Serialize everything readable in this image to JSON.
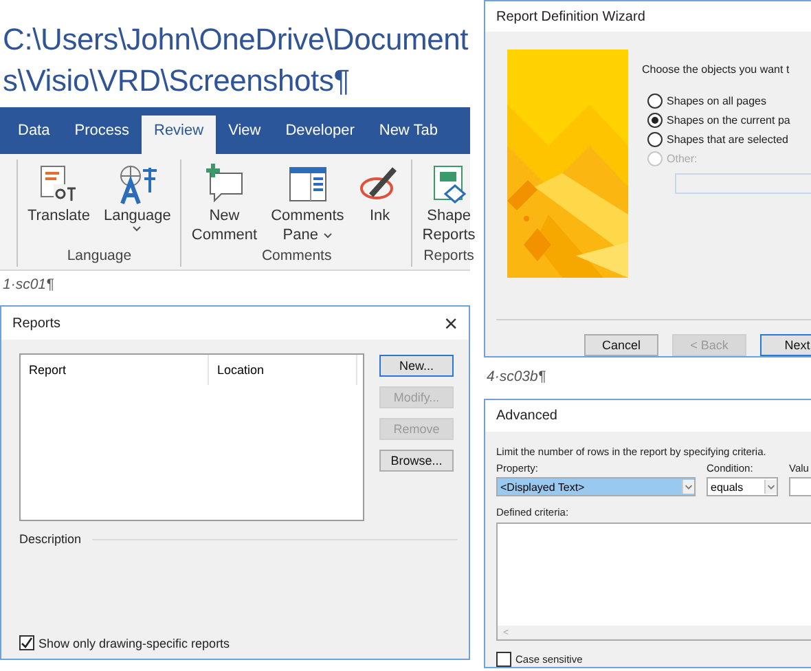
{
  "heading": {
    "lines": [
      "C:\\Users\\John\\OneDrive\\Document",
      "s\\Visio\\VRD\\Screenshots¶"
    ]
  },
  "ribbon": {
    "tabs": [
      {
        "label": "Data",
        "selected": false
      },
      {
        "label": "Process",
        "selected": false
      },
      {
        "label": "Review",
        "selected": true
      },
      {
        "label": "View",
        "selected": false
      },
      {
        "label": "Developer",
        "selected": false
      },
      {
        "label": "New Tab",
        "selected": false
      }
    ],
    "groups": [
      {
        "label": "Language",
        "commands": [
          {
            "kind": "translate",
            "lines": [
              "Translate"
            ],
            "dropdown": false
          },
          {
            "kind": "language",
            "lines": [
              "Language"
            ],
            "dropdown": true
          }
        ]
      },
      {
        "label": "Comments",
        "commands": [
          {
            "kind": "comment",
            "lines": [
              "New",
              "Comment"
            ],
            "dropdown": false
          },
          {
            "kind": "pane",
            "lines": [
              "Comments",
              "Pane"
            ],
            "dropdown": true
          },
          {
            "kind": "ink",
            "lines": [
              "Ink"
            ],
            "dropdown": false
          }
        ]
      },
      {
        "label": "Reports",
        "commands": [
          {
            "kind": "reports",
            "lines": [
              "Shape",
              "Reports"
            ],
            "dropdown": false
          }
        ]
      }
    ]
  },
  "caption_1": "1·sc01¶",
  "reports_dialog": {
    "title": "Reports",
    "close": "×",
    "columns": [
      "Report",
      "Location"
    ],
    "buttons": [
      {
        "label": "New...",
        "disabled": false,
        "default": true
      },
      {
        "label": "Modify...",
        "disabled": true,
        "default": false
      },
      {
        "label": "Remove",
        "disabled": true,
        "default": false
      },
      {
        "label": "Browse...",
        "disabled": false,
        "default": false
      }
    ],
    "description_label": "Description",
    "checkbox": {
      "label": "Show only drawing-specific reports",
      "checked": true
    }
  },
  "wizard": {
    "title": "Report Definition Wizard",
    "prompt": "Choose the objects you want t",
    "options": [
      {
        "label": "Shapes on all pages",
        "selected": false,
        "disabled": false
      },
      {
        "label": "Shapes on the current pa",
        "selected": true,
        "disabled": false
      },
      {
        "label": "Shapes that are selected",
        "selected": false,
        "disabled": false
      },
      {
        "label": "Other:",
        "selected": false,
        "disabled": true
      }
    ],
    "buttons": [
      {
        "label": "Cancel",
        "disabled": false,
        "default": false
      },
      {
        "label": "< Back",
        "disabled": true,
        "default": false
      },
      {
        "label": "Next",
        "disabled": false,
        "default": true
      }
    ]
  },
  "caption_2": "4·sc03b¶",
  "advanced": {
    "title": "Advanced",
    "instruction": "Limit the number of rows in the report by specifying criteria.",
    "property": {
      "label": "Property:",
      "value": "<Displayed Text>",
      "highlighted": true
    },
    "condition": {
      "label": "Condition:",
      "value": "equals",
      "highlighted": false
    },
    "value_label": "Valu",
    "criteria_label": "Defined criteria:",
    "scroll_arrow": "<",
    "checkbox": {
      "label": "Case sensitive",
      "checked": false
    }
  }
}
